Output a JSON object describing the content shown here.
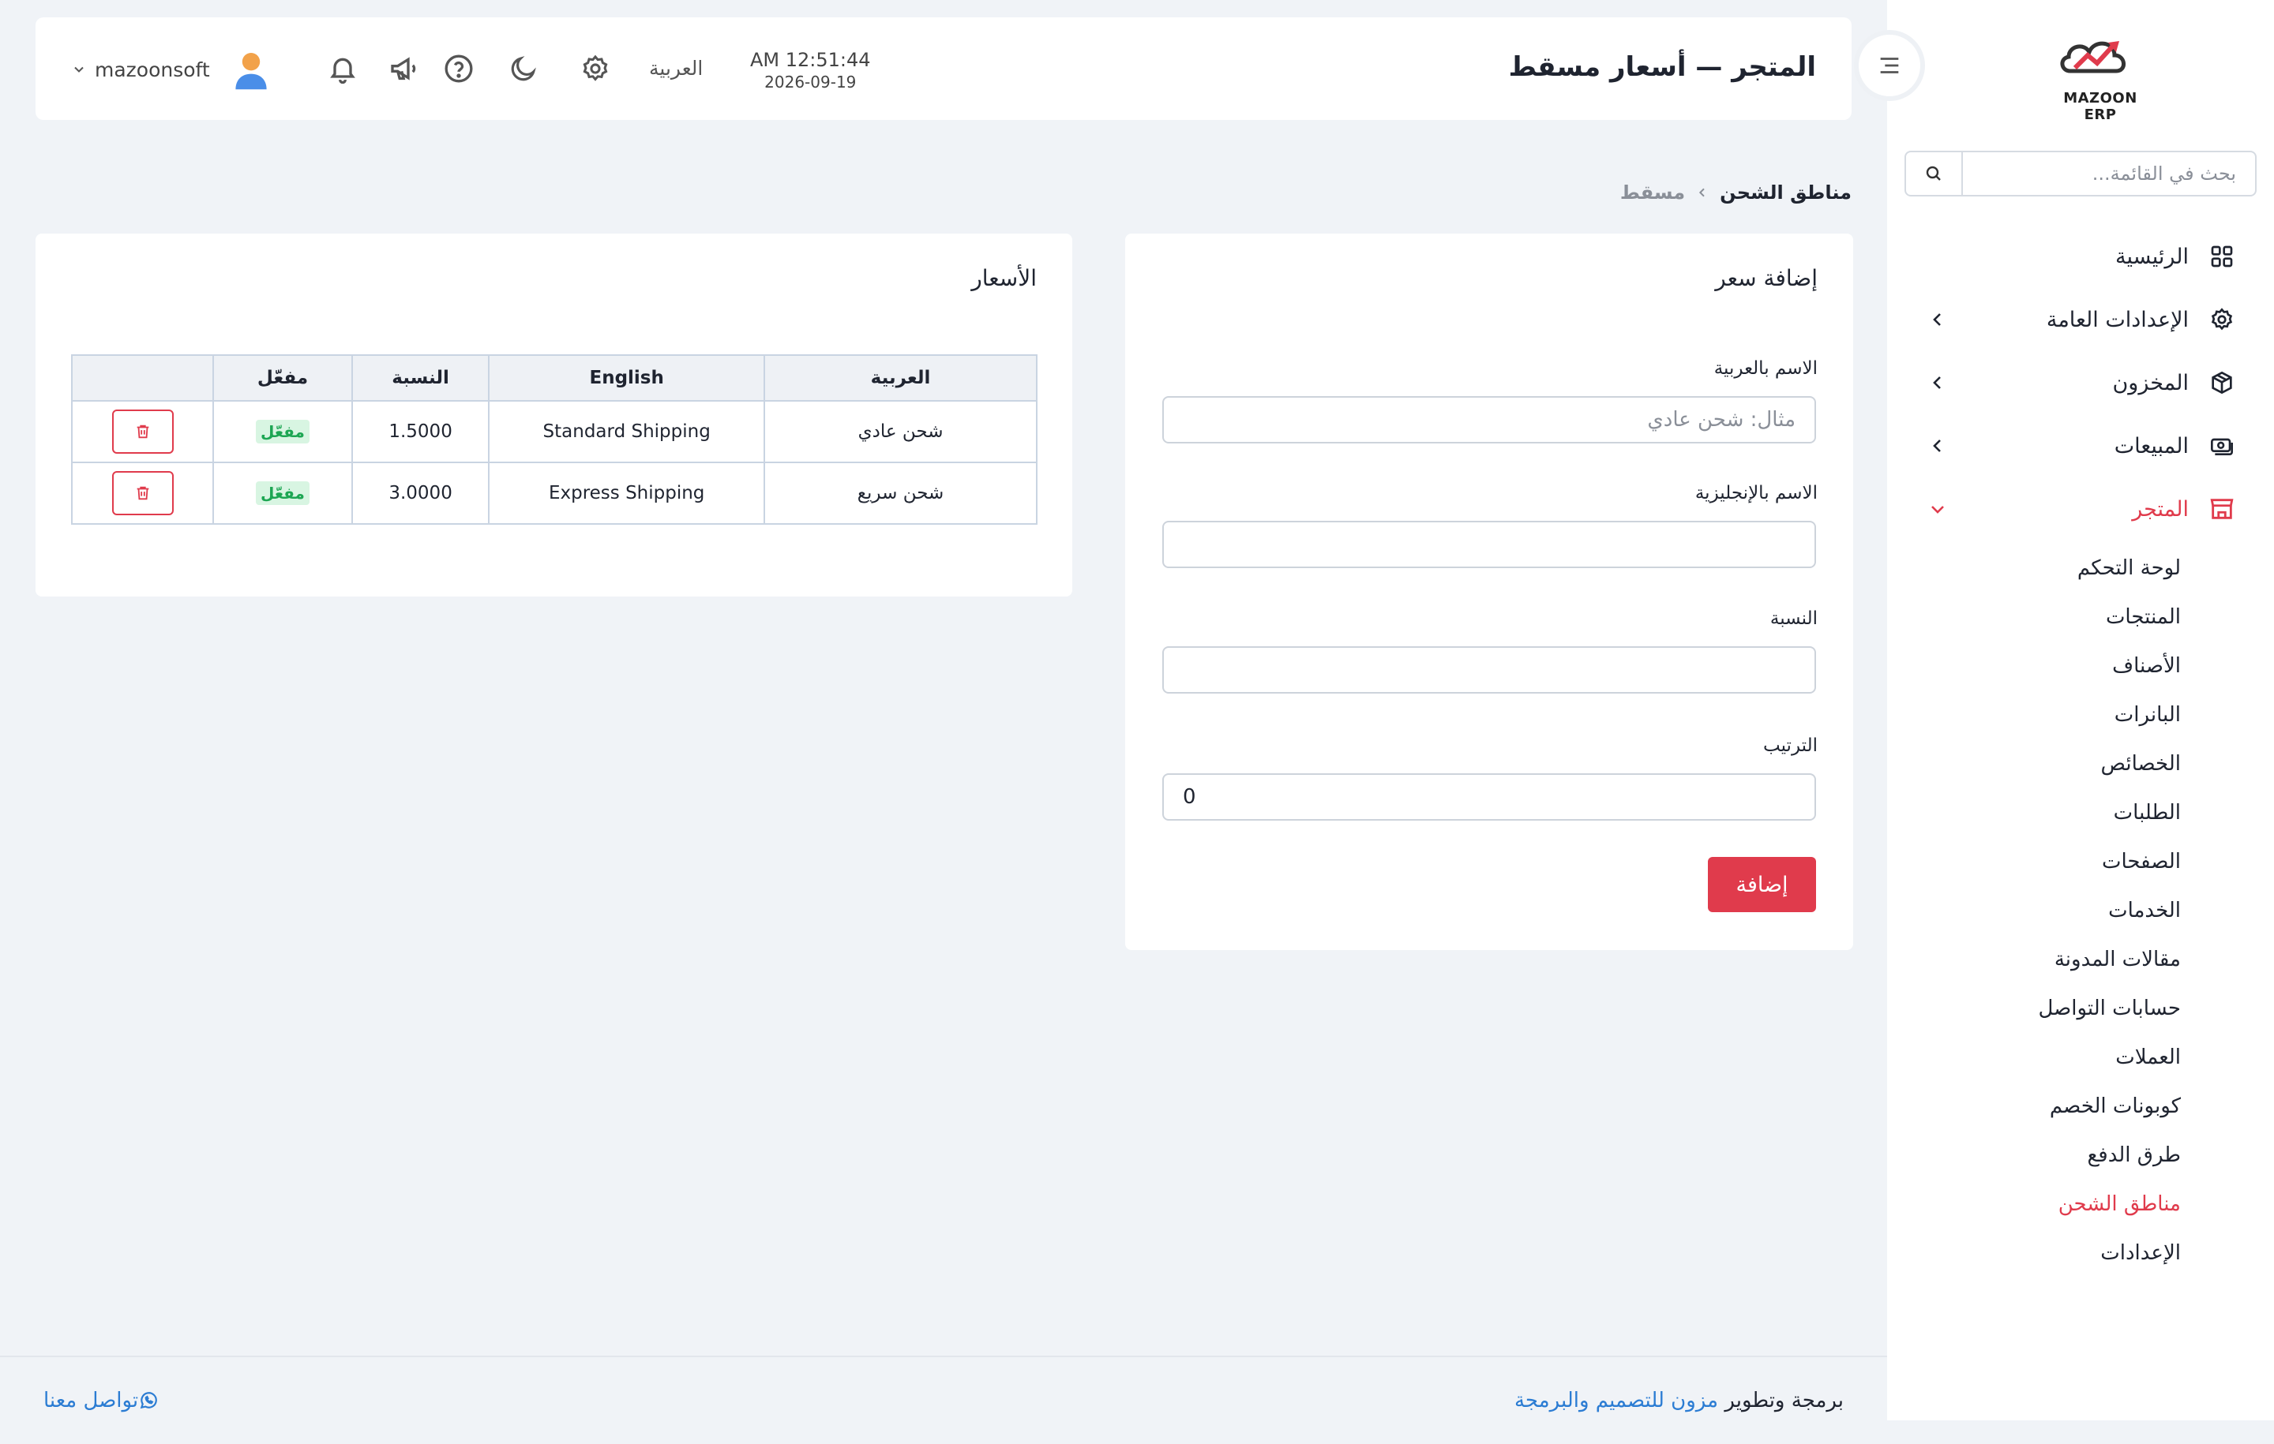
{
  "brand": {
    "logo_text": "MAZOON ERP",
    "accent": "#e03b4c",
    "link": "#2b7cd3"
  },
  "sidebar": {
    "search_placeholder": "بحث في القائمة...",
    "items": [
      {
        "label": "الرئيسية",
        "icon": "grid-icon"
      },
      {
        "label": "الإعدادات العامة",
        "icon": "gear-icon"
      },
      {
        "label": "المخزون",
        "icon": "box-icon"
      },
      {
        "label": "المبيعات",
        "icon": "cash-icon"
      },
      {
        "label": "المتجر",
        "icon": "store-icon"
      }
    ],
    "store_subitems": [
      "لوحة التحكم",
      "المنتجات",
      "الأصناف",
      "البانرات",
      "الخصائص",
      "الطلبات",
      "الصفحات",
      "الخدمات",
      "مقالات المدونة",
      "حسابات التواصل",
      "العملات",
      "كوبونات الخصم",
      "طرق الدفع",
      "مناطق الشحن",
      "الإعدادات"
    ]
  },
  "header": {
    "title": "المتجر — أسعار مسقط",
    "time": "AM 12:51:44",
    "date": "2026-09-19",
    "language": "العربية",
    "username": "mazoonsoft"
  },
  "breadcrumb": {
    "current": "مناطق الشحن",
    "link": "مسقط"
  },
  "form": {
    "title": "إضافة سعر",
    "name_ar_label": "الاسم بالعربية",
    "name_ar_placeholder": "مثال: شحن عادي",
    "name_en_label": "الاسم بالإنجليزية",
    "rate_label": "النسبة",
    "order_label": "الترتيب",
    "order_value": "0",
    "submit_label": "إضافة"
  },
  "prices": {
    "title": "الأسعار",
    "columns": [
      "العربية",
      "English",
      "النسبة",
      "مفعّل",
      ""
    ],
    "rows": [
      {
        "ar": "شحن عادي",
        "en": "Standard Shipping",
        "rate": "1.5000",
        "status": "مفعّل"
      },
      {
        "ar": "شحن سريع",
        "en": "Express Shipping",
        "rate": "3.0000",
        "status": "مفعّل"
      }
    ]
  },
  "footer": {
    "credit_prefix": "برمجة وتطوير ",
    "credit_company": "مزون للتصميم والبرمجة",
    "contact": "تواصل معنا"
  }
}
